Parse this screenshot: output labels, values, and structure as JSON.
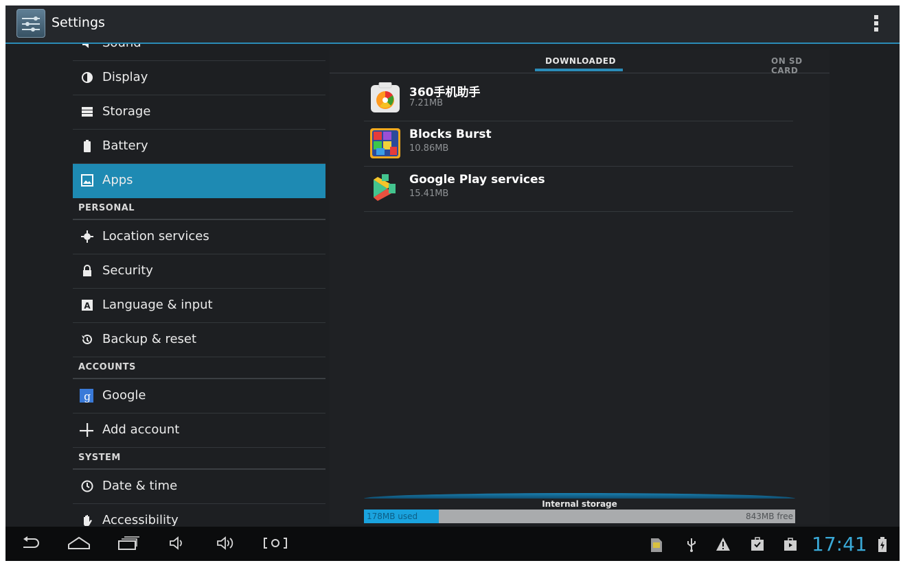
{
  "actionbar": {
    "title": "Settings",
    "icon": "settings-icon",
    "overflow_icon": "overflow-menu-icon"
  },
  "sidebar": {
    "partial_item": "Sound",
    "items_top": [
      {
        "label": "Display",
        "icon": "display-icon"
      },
      {
        "label": "Storage",
        "icon": "storage-icon"
      },
      {
        "label": "Battery",
        "icon": "battery-icon"
      },
      {
        "label": "Apps",
        "icon": "apps-icon",
        "selected": true
      }
    ],
    "personal_header": "PERSONAL",
    "items_personal": [
      {
        "label": "Location services",
        "icon": "location-icon"
      },
      {
        "label": "Security",
        "icon": "lock-icon"
      },
      {
        "label": "Language & input",
        "icon": "language-icon"
      },
      {
        "label": "Backup & reset",
        "icon": "backup-icon"
      }
    ],
    "accounts_header": "ACCOUNTS",
    "items_accounts": [
      {
        "label": "Google",
        "icon": "google-icon"
      },
      {
        "label": "Add account",
        "icon": "plus-icon"
      }
    ],
    "system_header": "SYSTEM",
    "items_system": [
      {
        "label": "Date & time",
        "icon": "clock-icon"
      },
      {
        "label": "Accessibility",
        "icon": "hand-icon"
      }
    ]
  },
  "main": {
    "tabs": [
      {
        "label": "DOWNLOADED",
        "active": true
      },
      {
        "label": "ON SD CARD",
        "active": false
      }
    ],
    "apps": [
      {
        "name": "360手机助手",
        "size": "7.21MB",
        "icon": "360-assistant-icon"
      },
      {
        "name": "Blocks Burst",
        "size": "10.86MB",
        "icon": "blocks-burst-icon"
      },
      {
        "name": "Google Play services",
        "size": "15.41MB",
        "icon": "play-services-icon"
      }
    ],
    "storage": {
      "label": "Internal storage",
      "used": "178MB used",
      "free": "843MB free",
      "used_fraction": 0.174
    }
  },
  "navbar": {
    "buttons": [
      "back-icon",
      "home-icon",
      "recent-apps-icon",
      "volume-down-icon",
      "volume-up-icon",
      "screenshot-icon"
    ],
    "status_icons": [
      "sd-card-icon",
      "usb-icon",
      "warning-icon",
      "download-done-icon",
      "store-icon"
    ],
    "time": "17:41",
    "battery_icon": "battery-charging-icon"
  },
  "colors": {
    "accent": "#2a8cb8",
    "selected_row": "#1e8ab3",
    "background": "#1d1f22",
    "clock": "#3aaad8"
  }
}
